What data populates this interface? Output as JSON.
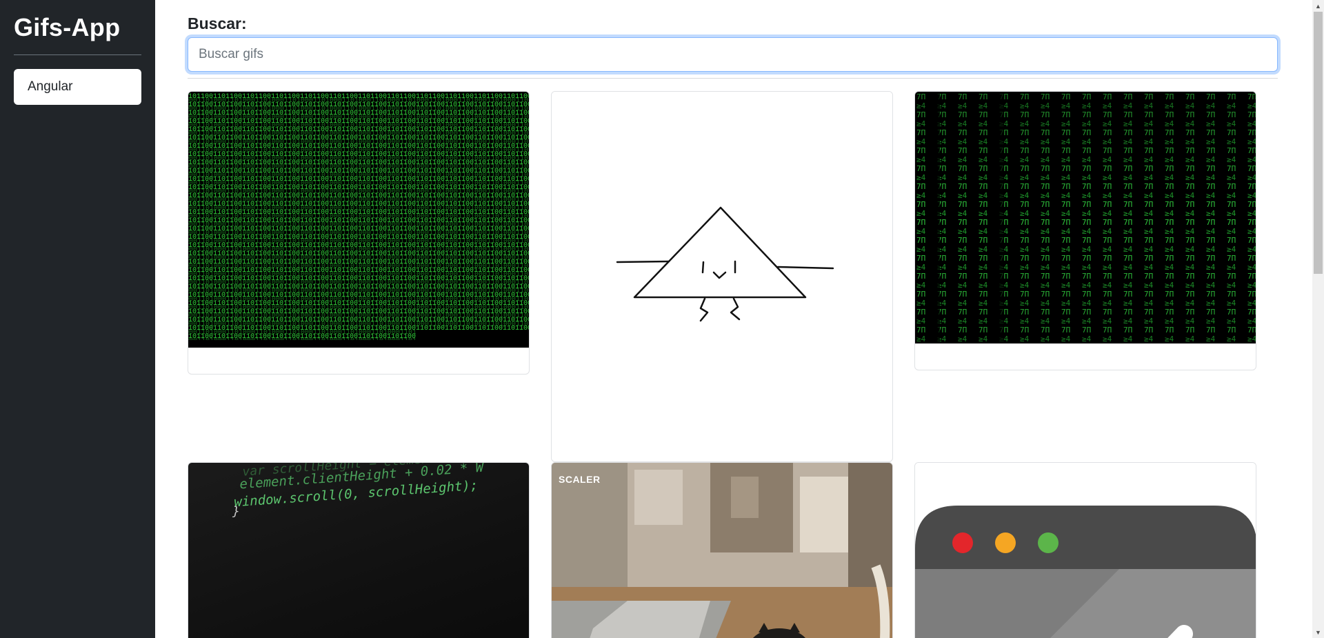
{
  "sidebar": {
    "brand": "Gifs-App",
    "history": [
      {
        "label": "Angular"
      }
    ]
  },
  "search": {
    "label": "Buscar:",
    "placeholder": "Buscar gifs",
    "value": ""
  },
  "cards": [
    {
      "icon": "binary-matrix-gif",
      "title": ""
    },
    {
      "icon": "triangle-character-gif",
      "title": ""
    },
    {
      "icon": "matrix-rain-gif",
      "title": ""
    },
    {
      "icon": "scroll-code-gif",
      "title": ""
    },
    {
      "icon": "cat-laptop-gif",
      "title": ""
    },
    {
      "icon": "browser-window-gif",
      "title": ""
    }
  ],
  "card_texts": {
    "code_line1": "var scrollHeight = element.scrollHeight",
    "code_line2": "element.clientHeight + 0.02 * W",
    "code_line3": "window.scroll(0, scrollHeight);",
    "code_line4": "}",
    "watermark": "SCALER"
  },
  "colors": {
    "sidebar_bg": "#212529",
    "focus_ring": "#86b7fe",
    "matrix_green": "#31d43a",
    "dot_red": "#e3262b",
    "dot_yellow": "#f5a623",
    "dot_green": "#5cb54a"
  }
}
